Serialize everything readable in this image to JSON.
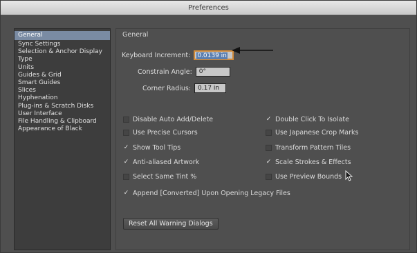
{
  "window": {
    "title": "Preferences"
  },
  "sidebar": {
    "items": [
      {
        "label": "General",
        "selected": true
      },
      {
        "label": "Sync Settings"
      },
      {
        "label": "Selection & Anchor Display"
      },
      {
        "label": "Type"
      },
      {
        "label": "Units"
      },
      {
        "label": "Guides & Grid"
      },
      {
        "label": "Smart Guides"
      },
      {
        "label": "Slices"
      },
      {
        "label": "Hyphenation"
      },
      {
        "label": "Plug-ins & Scratch Disks"
      },
      {
        "label": "User Interface"
      },
      {
        "label": "File Handling & Clipboard"
      },
      {
        "label": "Appearance of Black"
      }
    ]
  },
  "panel": {
    "title": "General",
    "fields": {
      "keyboard_increment": {
        "label": "Keyboard Increment:",
        "value": "0.0139 in"
      },
      "constrain_angle": {
        "label": "Constrain Angle:",
        "value": "0°"
      },
      "corner_radius": {
        "label": "Corner Radius:",
        "value": "0.17 in"
      }
    },
    "checks": {
      "disable_auto_add": {
        "label": "Disable Auto Add/Delete",
        "checked": false
      },
      "double_click_isolate": {
        "label": "Double Click To Isolate",
        "checked": true
      },
      "precise_cursors": {
        "label": "Use Precise Cursors",
        "checked": false
      },
      "japanese_crop": {
        "label": "Use Japanese Crop Marks",
        "checked": false
      },
      "show_tool_tips": {
        "label": "Show Tool Tips",
        "checked": true
      },
      "transform_pattern": {
        "label": "Transform Pattern Tiles",
        "checked": false
      },
      "anti_aliased": {
        "label": "Anti-aliased Artwork",
        "checked": true
      },
      "scale_strokes": {
        "label": "Scale Strokes & Effects",
        "checked": true
      },
      "same_tint": {
        "label": "Select Same Tint %",
        "checked": false
      },
      "preview_bounds": {
        "label": "Use Preview Bounds",
        "checked": false
      },
      "append_converted": {
        "label": "Append [Converted] Upon Opening Legacy Files",
        "checked": true
      }
    },
    "reset_button": "Reset All Warning Dialogs"
  },
  "check_glyph": "✓"
}
